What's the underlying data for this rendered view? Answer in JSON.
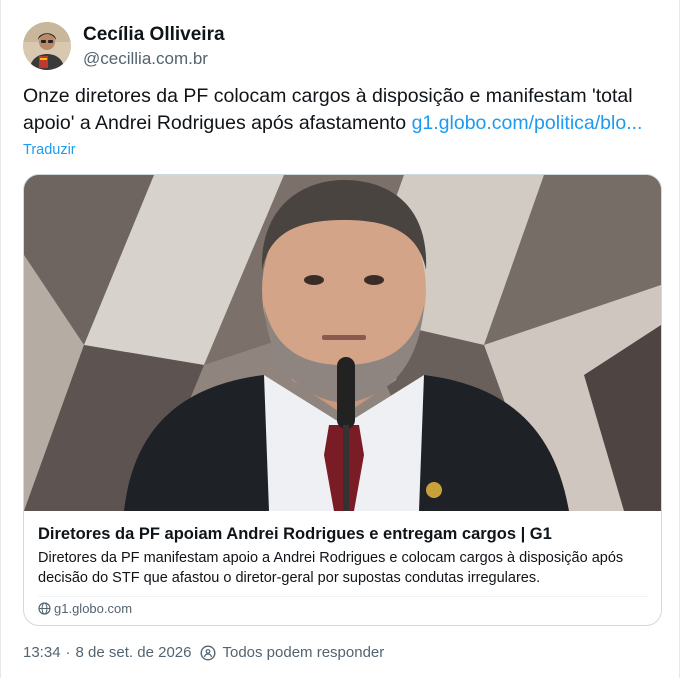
{
  "author": {
    "display_name": "Cecília Olliveira",
    "handle": "@cecillia.com.br"
  },
  "post": {
    "text": "Onze diretores da PF colocam cargos à disposição e manifestam 'total apoio' a Andrei Rodrigues após afastamento ",
    "link_text": "g1.globo.com/politica/blo...",
    "translate_label": "Traduzir"
  },
  "link_card": {
    "title": "Diretores da PF apoiam Andrei Rodrigues e entregam cargos | G1",
    "description": "Diretores da PF manifestam apoio a Andrei Rodrigues e colocam cargos à disposição após decisão do STF que afastou o diretor-geral por supostas condutas irregulares.",
    "domain": "g1.globo.com"
  },
  "meta": {
    "time": "13:34",
    "separator": "·",
    "date": "8 de set. de 2026",
    "reply_setting": "Todos podem responder"
  },
  "icons": {
    "globe": "globe-icon",
    "reply_setting": "reply-setting-icon"
  }
}
